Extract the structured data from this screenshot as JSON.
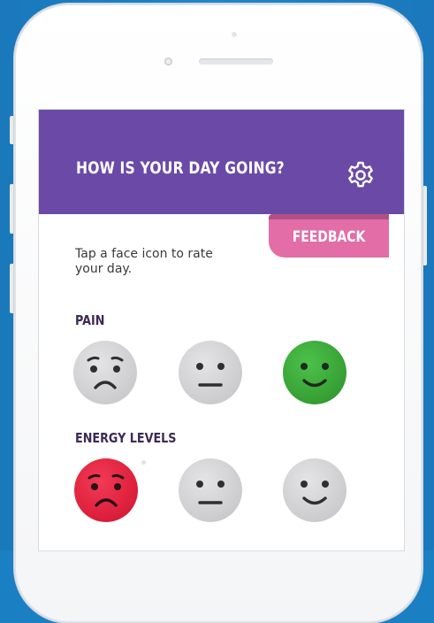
{
  "header": {
    "title": "HOW IS YOUR DAY GOING?",
    "settings_icon": "gear-icon",
    "color": "#6a4aa6"
  },
  "feedback": {
    "label": "FEEDBACK",
    "color": "#e26da7"
  },
  "prompt": "Tap a face icon to rate your day.",
  "sections": [
    {
      "label": "PAIN",
      "faces": [
        {
          "icon": "sad-face-icon",
          "selected": false,
          "color": "#d6d6d8"
        },
        {
          "icon": "neutral-face-icon",
          "selected": false,
          "color": "#d6d6d8"
        },
        {
          "icon": "happy-face-icon",
          "selected": true,
          "color": "#3fae3d"
        }
      ]
    },
    {
      "label": "ENERGY LEVELS",
      "faces": [
        {
          "icon": "sad-face-icon",
          "selected": true,
          "color": "#e8213f"
        },
        {
          "icon": "neutral-face-icon",
          "selected": false,
          "color": "#d6d6d8"
        },
        {
          "icon": "happy-face-icon",
          "selected": false,
          "color": "#d6d6d8"
        }
      ]
    }
  ],
  "background_color": "#1b7fc4"
}
